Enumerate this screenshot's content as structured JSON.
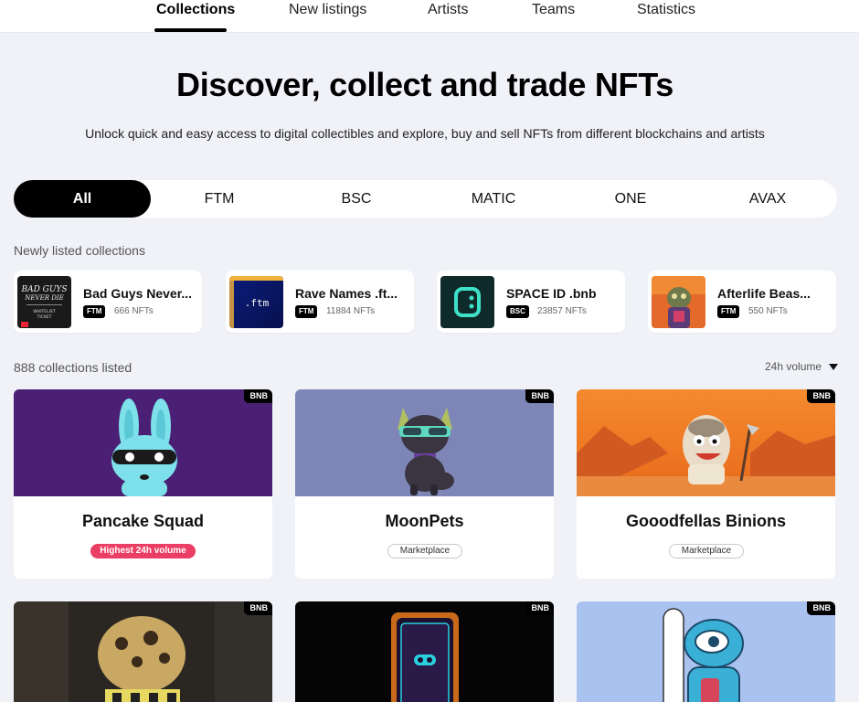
{
  "nav": {
    "tabs": [
      "Collections",
      "New listings",
      "Artists",
      "Teams",
      "Statistics"
    ],
    "active": "Collections"
  },
  "hero": {
    "title": "Discover, collect and trade NFTs",
    "subtitle": "Unlock quick and easy access to digital collectibles and explore, buy and sell NFTs from different blockchains and artists"
  },
  "chains": [
    "All",
    "FTM",
    "BSC",
    "MATIC",
    "ONE",
    "AVAX"
  ],
  "newly_listed": {
    "label": "Newly listed collections",
    "items": [
      {
        "name": "Bad Guys Never...",
        "chain": "FTM",
        "count": "666 NFTs"
      },
      {
        "name": "Rave Names .ft...",
        "chain": "FTM",
        "count": "11884 NFTs",
        "thumb_text": ".ftm"
      },
      {
        "name": "SPACE ID .bnb",
        "chain": "BSC",
        "count": "23857 NFTs"
      },
      {
        "name": "Afterlife Beas...",
        "chain": "FTM",
        "count": "550 NFTs"
      }
    ]
  },
  "collections": {
    "count_label": "888 collections listed",
    "sort_label": "24h volume",
    "items": [
      {
        "name": "Pancake Squad",
        "chain": "BNB",
        "tag": "Highest 24h volume",
        "tag_type": "hot"
      },
      {
        "name": "MoonPets",
        "chain": "BNB",
        "tag": "Marketplace",
        "tag_type": "market"
      },
      {
        "name": "Gooodfellas Binions",
        "chain": "BNB",
        "tag": "Marketplace",
        "tag_type": "market"
      },
      {
        "name": "",
        "chain": "BNB"
      },
      {
        "name": "",
        "chain": "BNB"
      },
      {
        "name": "",
        "chain": "BNB"
      }
    ]
  },
  "colors": {
    "accent_pink": "#ea3e65",
    "black": "#000000",
    "page_bg": "#f1f2f7"
  }
}
